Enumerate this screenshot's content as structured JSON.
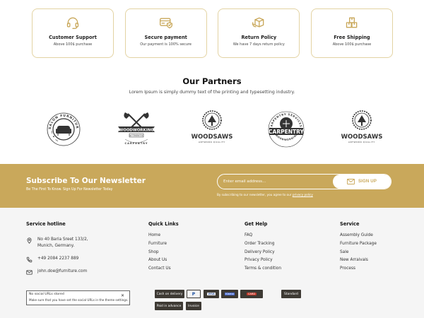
{
  "features": [
    {
      "title": "Customer Support",
      "subtitle": "Above 100$ purchase",
      "icon": "headset-icon"
    },
    {
      "title": "Secure payment",
      "subtitle": "Our payment is 100% secure",
      "icon": "credit-card-icon"
    },
    {
      "title": "Return Policy",
      "subtitle": "We have 7 days return policy",
      "icon": "return-box-icon"
    },
    {
      "title": "Free Shipping",
      "subtitle": "Above 100$ purchase",
      "icon": "shipping-boxes-icon"
    }
  ],
  "partners": {
    "title": "Our Partners",
    "subtitle": "Lorem Ipsum is simply dummy text of the printing and typesetting industry.",
    "logos": [
      {
        "name": "salon-furniture-logo",
        "ring_text": "SALON FURNITURE",
        "main": "",
        "sub": ""
      },
      {
        "name": "woodworking-logo",
        "ring_text": "",
        "main": "WOODWORKING",
        "sub": "CARPENTRY"
      },
      {
        "name": "woodsaws-logo",
        "ring_text": "",
        "main": "WOODSAWS",
        "sub": "ARTWORK QUALITY"
      },
      {
        "name": "carpentry-logo",
        "ring_text": "CARPENTRY SERVICES",
        "main": "CARPENTRY",
        "sub": "WOODWORKING"
      },
      {
        "name": "woodsaws-logo-2",
        "ring_text": "",
        "main": "WOODSAWS",
        "sub": "ARTWORK QUALITY"
      }
    ]
  },
  "newsletter": {
    "title": "Subscribe To Our Newsletter",
    "subtitle": "Be The First To Know. Sign Up For Newsletter Today",
    "placeholder": "Enter email address...",
    "button_label": "SIGN UP",
    "note_prefix": "By subscribing to our newsletter, you agree to our",
    "note_link": "privacy policy",
    "bg_color": "#c9a85b"
  },
  "footer": {
    "hotline": {
      "heading": "Service hotline",
      "address_line1": "No 40 Baria Sreet 133/2,",
      "address_line2": "Munich, Germany.",
      "phone": "+49 2084 2237 889",
      "email": "john.doe@furniture.com"
    },
    "quick_links": {
      "heading": "Quick Links",
      "items": [
        "Home",
        "Furniture",
        "Shop",
        "About Us",
        "Contact Us"
      ]
    },
    "get_help": {
      "heading": "Get Help",
      "items": [
        "FAQ",
        "Order Tracking",
        "Delivery Policy",
        "Privacy Policy",
        "Terms & condition"
      ]
    },
    "service": {
      "heading": "Service",
      "items": [
        "Assembly Guide",
        "Furniture Package",
        "Sale",
        "New Arraivals",
        "Process"
      ]
    },
    "social_notice": {
      "title": "No social URLs stored",
      "subtitle": "Make sure that you have set the social URLs in the theme settings.",
      "close": "✕"
    },
    "payments": {
      "cash_on_delivery": "Cash on delivery",
      "paypal": "P",
      "cards": "VISA",
      "klarna": "Klarna",
      "creditcard": "CARD",
      "standard": "Standard",
      "paid_in_advance": "Paid in advance",
      "invoice": "Invoice"
    }
  }
}
